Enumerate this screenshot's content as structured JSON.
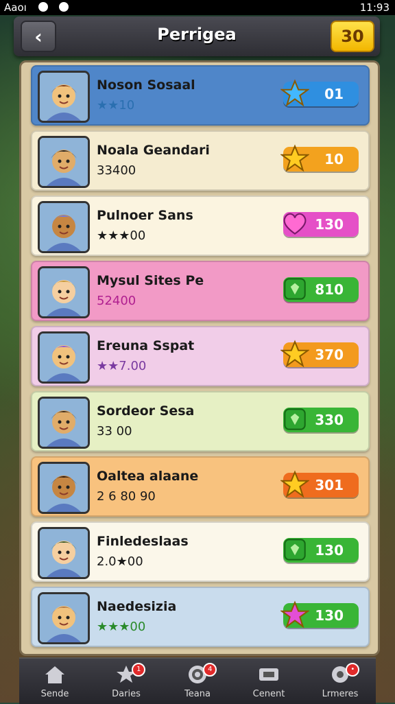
{
  "status": {
    "left": "Aaoı",
    "time": "11:93"
  },
  "header": {
    "title": "Perrigea",
    "coins": "30"
  },
  "rows": [
    {
      "name": "Noson Sosaal",
      "score": "★★10",
      "score_color": "#2a6fb0",
      "bg": "#4f86c9",
      "pill_label": "01",
      "pill_color": "#2f8fe0",
      "icon": "star-icon",
      "icon_color": "#42b8ff"
    },
    {
      "name": "Noala Geandari",
      "score": "33400",
      "score_color": "#1a1a1a",
      "bg": "#f5ecd0",
      "pill_label": "10",
      "pill_color": "#f3a21e",
      "icon": "star-icon",
      "icon_color": "#ffcc22"
    },
    {
      "name": "Pulnoer Sans",
      "score": "★★★00",
      "score_color": "#1a1a1a",
      "bg": "#fbf4e0",
      "pill_label": "130",
      "pill_color": "#e550c7",
      "icon": "heart-icon",
      "icon_color": "#ff6ad2"
    },
    {
      "name": "Mysul Sites Pe",
      "score": "52400",
      "score_color": "#b02090",
      "bg": "#f29ac6",
      "pill_label": "810",
      "pill_color": "#39b536",
      "icon": "gem-icon",
      "icon_color": "#2ea630"
    },
    {
      "name": "Ereuna Sspat",
      "score": "★★7.00",
      "score_color": "#7a3aa0",
      "bg": "#f1cde8",
      "pill_label": "370",
      "pill_color": "#f39a1e",
      "icon": "star-icon",
      "icon_color": "#ffcc22"
    },
    {
      "name": "Sordeor Sesa",
      "score": "33 00",
      "score_color": "#1a1a1a",
      "bg": "#e6f0c4",
      "pill_label": "330",
      "pill_color": "#39b536",
      "icon": "gem-icon",
      "icon_color": "#2ea630"
    },
    {
      "name": "Oaltea alaane",
      "score": "2 6 80 90",
      "score_color": "#1a1a1a",
      "bg": "#f8c27e",
      "pill_label": "301",
      "pill_color": "#ef6c1e",
      "icon": "star-icon",
      "icon_color": "#ffcc22"
    },
    {
      "name": "Finledeslaas",
      "score": "2.0★00",
      "score_color": "#1a1a1a",
      "bg": "#fbf7ea",
      "pill_label": "130",
      "pill_color": "#39b536",
      "icon": "gem-icon",
      "icon_color": "#2ea630"
    },
    {
      "name": "Naedesizia",
      "score": "★★★00",
      "score_color": "#2a8a2a",
      "bg": "#c9dced",
      "pill_label": "130",
      "pill_color": "#39b536",
      "icon": "star-icon",
      "icon_color": "#e44ed6"
    }
  ],
  "nav": [
    {
      "label": "Sende",
      "icon": "home-icon",
      "badge": ""
    },
    {
      "label": "Daries",
      "icon": "star-icon",
      "badge": "1"
    },
    {
      "label": "Teana",
      "icon": "target-icon",
      "badge": "4"
    },
    {
      "label": "Cenent",
      "icon": "ticket-icon",
      "badge": ""
    },
    {
      "label": "Lrmeres",
      "icon": "gear-icon",
      "badge": "•"
    }
  ]
}
